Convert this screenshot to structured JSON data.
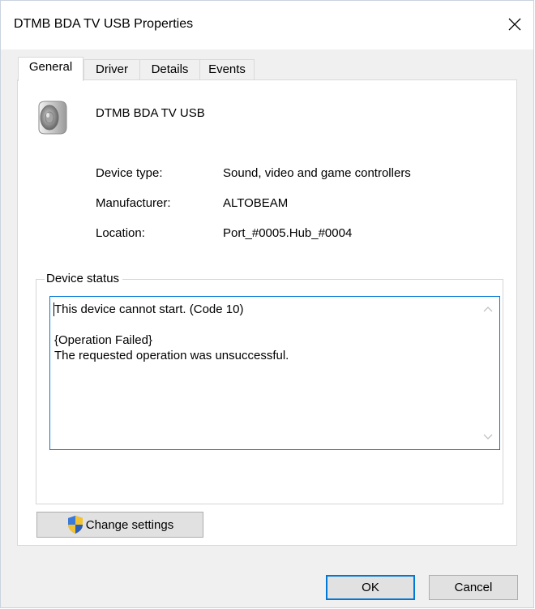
{
  "window": {
    "title": "DTMB BDA TV USB Properties"
  },
  "tabs": [
    {
      "label": "General",
      "active": true
    },
    {
      "label": "Driver",
      "active": false
    },
    {
      "label": "Details",
      "active": false
    },
    {
      "label": "Events",
      "active": false
    }
  ],
  "device": {
    "icon": "speaker-icon",
    "name": "DTMB BDA TV USB"
  },
  "properties": [
    {
      "label": "Device type:",
      "value": "Sound, video and game controllers"
    },
    {
      "label": "Manufacturer:",
      "value": "ALTOBEAM"
    },
    {
      "label": "Location:",
      "value": "Port_#0005.Hub_#0004"
    }
  ],
  "device_status": {
    "legend": "Device status",
    "lines": [
      "This device cannot start. (Code 10)",
      "",
      "{Operation Failed}",
      "The requested operation was unsuccessful."
    ]
  },
  "change_settings": {
    "label": "Change settings",
    "icon": "uac-shield-icon"
  },
  "footer": {
    "ok_label": "OK",
    "cancel_label": "Cancel"
  },
  "colors": {
    "accent": "#0078d7",
    "dialog_background": "#f0f0f0",
    "button_face": "#e1e1e1"
  }
}
